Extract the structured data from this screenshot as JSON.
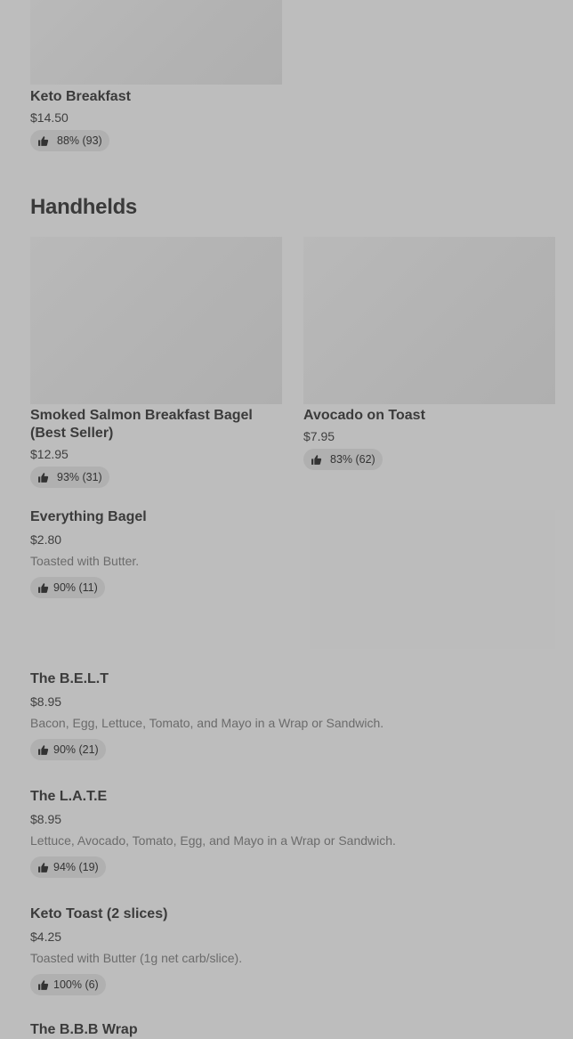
{
  "items": [
    {
      "name": "Keto Breakfast",
      "price": "$14.50",
      "rating": "88% (93)"
    },
    {
      "name": "Smoked Salmon Breakfast Bagel",
      "name2": "(Best Seller)",
      "price": "$12.95",
      "rating": "93% (31)"
    },
    {
      "name": "Avocado on Toast",
      "price": "$7.95",
      "rating": "83% (62)"
    },
    {
      "name": "Everything Bagel",
      "price": "$2.80",
      "description": "Toasted with Butter.",
      "rating": "90% (11)"
    },
    {
      "name": "The B.E.L.T",
      "price": "$8.95",
      "description": "Bacon, Egg, Lettuce, Tomato, and Mayo in a Wrap or Sandwich.",
      "rating": "90% (21)"
    },
    {
      "name": "The L.A.T.E",
      "price": "$8.95",
      "description": "Lettuce, Avocado, Tomato, Egg, and Mayo in a Wrap or Sandwich.",
      "rating": "94% (19)"
    },
    {
      "name": "Keto Toast (2 slices)",
      "price": "$4.25",
      "description": "Toasted with Butter (1g net carb/slice).",
      "rating": "100% (6)"
    },
    {
      "name": "The B.B.B Wrap"
    }
  ],
  "sections": {
    "handhelds": "Handhelds"
  },
  "icons": {
    "rating": "thumbs-up-icon"
  }
}
